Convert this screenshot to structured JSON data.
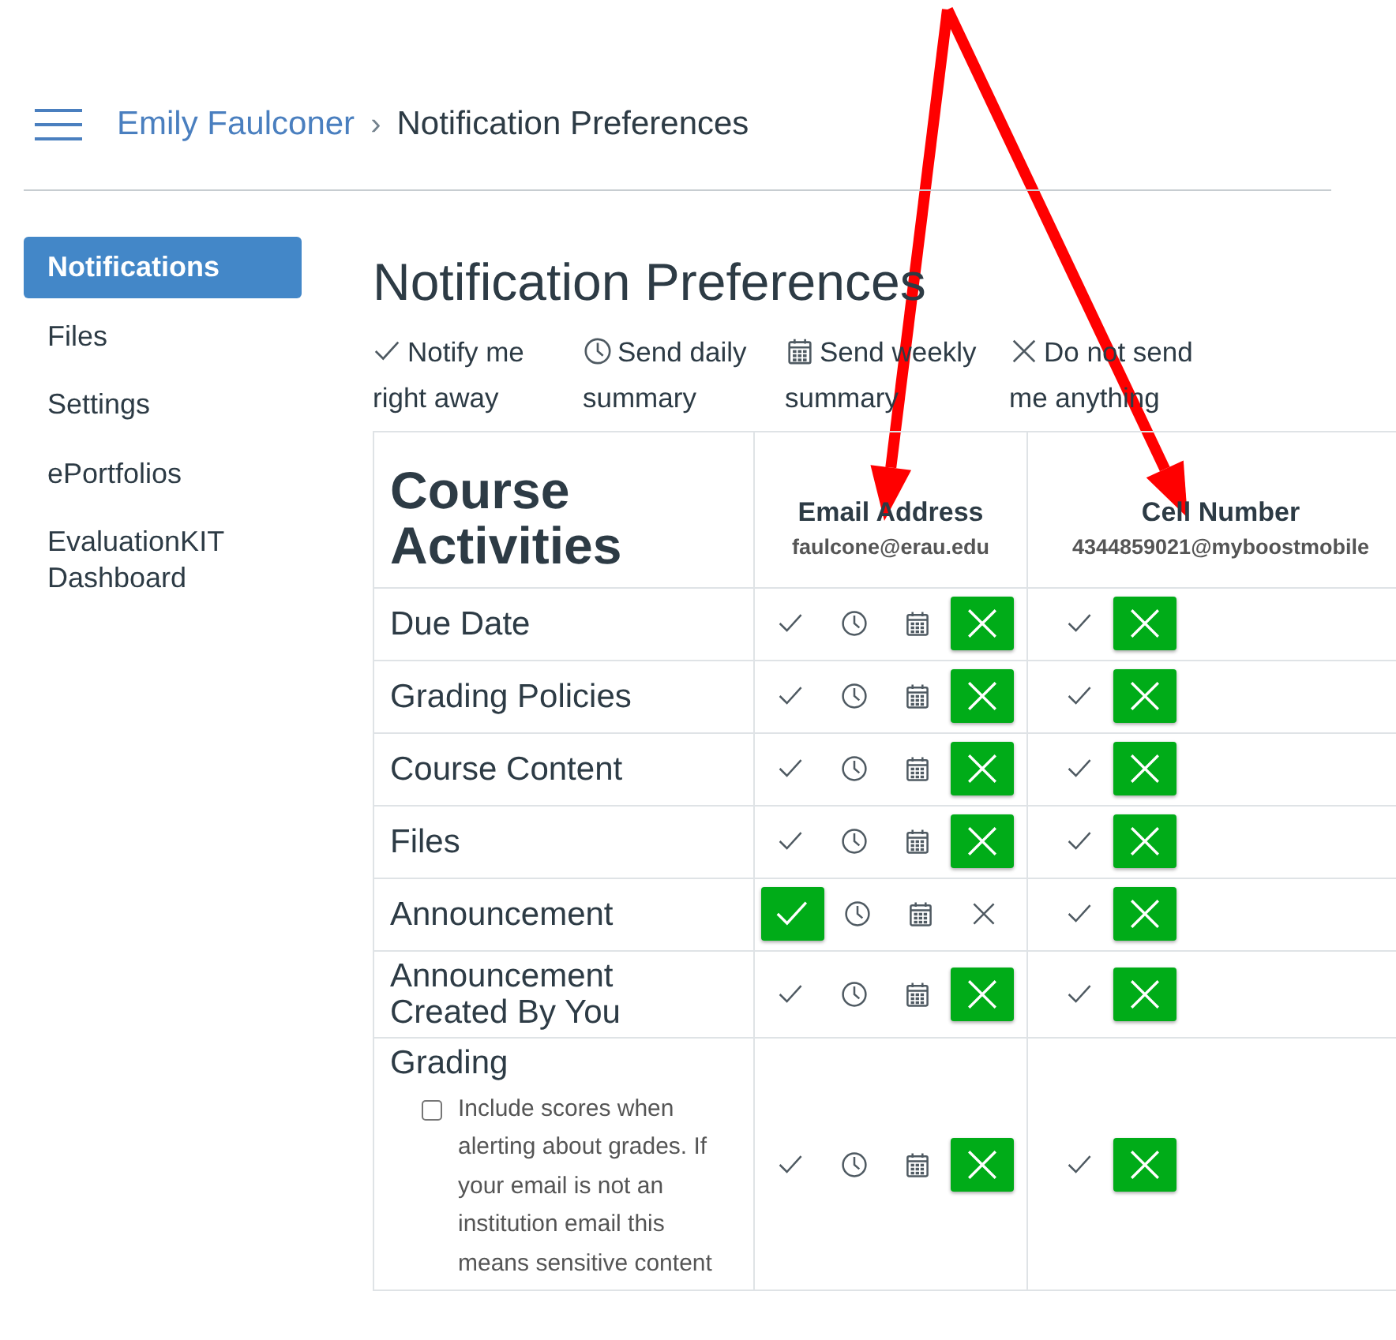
{
  "breadcrumb": {
    "parent": "Emily Faulconer",
    "separator": "›",
    "current": "Notification Preferences"
  },
  "sidebar": {
    "items": [
      {
        "label": "Notifications",
        "selected": true
      },
      {
        "label": "Files",
        "selected": false
      },
      {
        "label": "Settings",
        "selected": false
      },
      {
        "label": "ePortfolios",
        "selected": false
      },
      {
        "label": "EvaluationKIT Dashboard",
        "selected": false
      }
    ]
  },
  "title": "Notification Preferences",
  "legend": [
    {
      "kind": "immediately",
      "label": "Notify me right away"
    },
    {
      "kind": "daily",
      "label": "Send daily summary"
    },
    {
      "kind": "weekly",
      "label": "Send weekly summary"
    },
    {
      "kind": "never",
      "label": "Do not send me anything"
    }
  ],
  "table": {
    "category_heading": "Course Activities",
    "channels": [
      {
        "name": "Email Address",
        "address": "faulcone@erau.edu"
      },
      {
        "name": "Cell Number",
        "address": "4344859021@myboostmobile"
      }
    ],
    "rows": [
      {
        "label": "Due Date",
        "email": [
          {
            "kind": "immediately",
            "selected": false
          },
          {
            "kind": "daily",
            "selected": false
          },
          {
            "kind": "weekly",
            "selected": false
          },
          {
            "kind": "never",
            "selected": true
          }
        ],
        "cell": [
          {
            "kind": "immediately",
            "selected": false
          },
          {
            "kind": "never",
            "selected": true
          }
        ]
      },
      {
        "label": "Grading Policies",
        "email": [
          {
            "kind": "immediately",
            "selected": false
          },
          {
            "kind": "daily",
            "selected": false
          },
          {
            "kind": "weekly",
            "selected": false
          },
          {
            "kind": "never",
            "selected": true
          }
        ],
        "cell": [
          {
            "kind": "immediately",
            "selected": false
          },
          {
            "kind": "never",
            "selected": true
          }
        ]
      },
      {
        "label": "Course Content",
        "email": [
          {
            "kind": "immediately",
            "selected": false
          },
          {
            "kind": "daily",
            "selected": false
          },
          {
            "kind": "weekly",
            "selected": false
          },
          {
            "kind": "never",
            "selected": true
          }
        ],
        "cell": [
          {
            "kind": "immediately",
            "selected": false
          },
          {
            "kind": "never",
            "selected": true
          }
        ]
      },
      {
        "label": "Files",
        "email": [
          {
            "kind": "immediately",
            "selected": false
          },
          {
            "kind": "daily",
            "selected": false
          },
          {
            "kind": "weekly",
            "selected": false
          },
          {
            "kind": "never",
            "selected": true
          }
        ],
        "cell": [
          {
            "kind": "immediately",
            "selected": false
          },
          {
            "kind": "never",
            "selected": true
          }
        ]
      },
      {
        "label": "Announcement",
        "email": [
          {
            "kind": "immediately",
            "selected": true
          },
          {
            "kind": "daily",
            "selected": false
          },
          {
            "kind": "weekly",
            "selected": false
          },
          {
            "kind": "never",
            "selected": false
          }
        ],
        "cell": [
          {
            "kind": "immediately",
            "selected": false
          },
          {
            "kind": "never",
            "selected": true
          }
        ]
      },
      {
        "label": "Announcement Created By You",
        "email": [
          {
            "kind": "immediately",
            "selected": false
          },
          {
            "kind": "daily",
            "selected": false
          },
          {
            "kind": "weekly",
            "selected": false
          },
          {
            "kind": "never",
            "selected": true
          }
        ],
        "cell": [
          {
            "kind": "immediately",
            "selected": false
          },
          {
            "kind": "never",
            "selected": true
          }
        ]
      },
      {
        "label": "Grading",
        "option": {
          "label": "Include scores when alerting about grades. If your email is not an institution email this means sensitive content",
          "checked": false
        },
        "email": [
          {
            "kind": "immediately",
            "selected": false
          },
          {
            "kind": "daily",
            "selected": false
          },
          {
            "kind": "weekly",
            "selected": false
          },
          {
            "kind": "never",
            "selected": true
          }
        ],
        "cell": [
          {
            "kind": "immediately",
            "selected": false
          },
          {
            "kind": "never",
            "selected": true
          }
        ]
      }
    ]
  },
  "annotation": {
    "kind": "arrows"
  }
}
